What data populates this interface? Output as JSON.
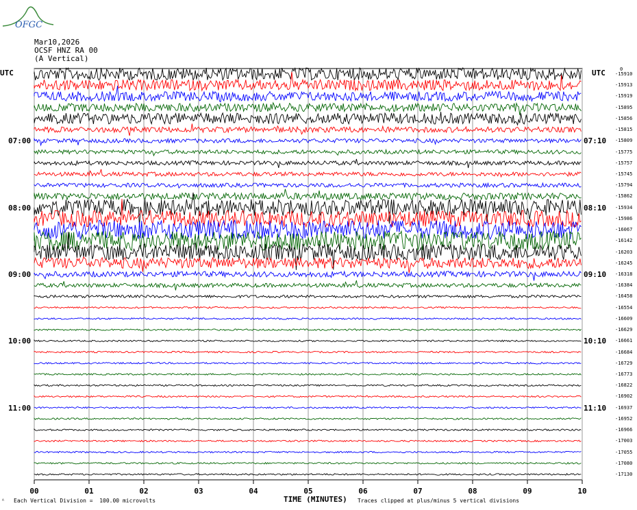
{
  "header": {
    "date": "Mar10,2026",
    "station": "OCSF HNZ RA 00",
    "component": "(A Vertical)",
    "logo_text": "OFGC"
  },
  "utc_left": "UTC",
  "utc_right": "UTC",
  "corner_label": "0",
  "left_hour_labels": [
    "07:00",
    "08:00",
    "09:00",
    "10:00",
    "11:00"
  ],
  "right_hour_labels": [
    "07:10",
    "08:10",
    "09:10",
    "10:10",
    "11:10"
  ],
  "footer": {
    "scale": "Each Vertical Division =  100.00 microvolts",
    "clip": "Traces clipped at plus/minus 5 vertical divisions",
    "xlabel": "TIME (MINUTES)"
  },
  "chart_data": {
    "type": "line",
    "title": "",
    "xlabel": "TIME (MINUTES)",
    "ylabel": "",
    "xlim": [
      0,
      10
    ],
    "x_ticks": [
      "00",
      "01",
      "02",
      "03",
      "04",
      "05",
      "06",
      "07",
      "08",
      "09",
      "10"
    ],
    "trace_colors": [
      "#000000",
      "#ff0000",
      "#0000ff",
      "#006400"
    ],
    "grid": "vertical lines each minute",
    "trace_offsets": [
      -15910,
      -15913,
      -15919,
      -15895,
      -15856,
      -15815,
      -15809,
      -15775,
      -15757,
      -15745,
      -15794,
      -15862,
      -15934,
      -15986,
      -16067,
      -16142,
      -16203,
      -16245,
      -16318,
      -16384,
      -16458,
      -16554,
      -16609,
      -16629,
      -16661,
      -16684,
      -16729,
      -16773,
      -16822,
      -16902,
      -16937,
      -16952,
      -16966,
      -17003,
      -17055,
      -17080,
      -17130
    ],
    "trace_amplitudes": [
      9,
      8,
      7,
      6,
      8,
      4,
      3,
      3,
      3,
      3,
      3,
      5,
      12,
      12,
      14,
      14,
      12,
      8,
      4,
      3,
      2,
      1.2,
      1.2,
      1.2,
      1.2,
      1.2,
      1.2,
      1.2,
      1.2,
      1.2,
      1.2,
      1.2,
      1.2,
      1.2,
      1.2,
      1.2,
      1.2
    ]
  }
}
